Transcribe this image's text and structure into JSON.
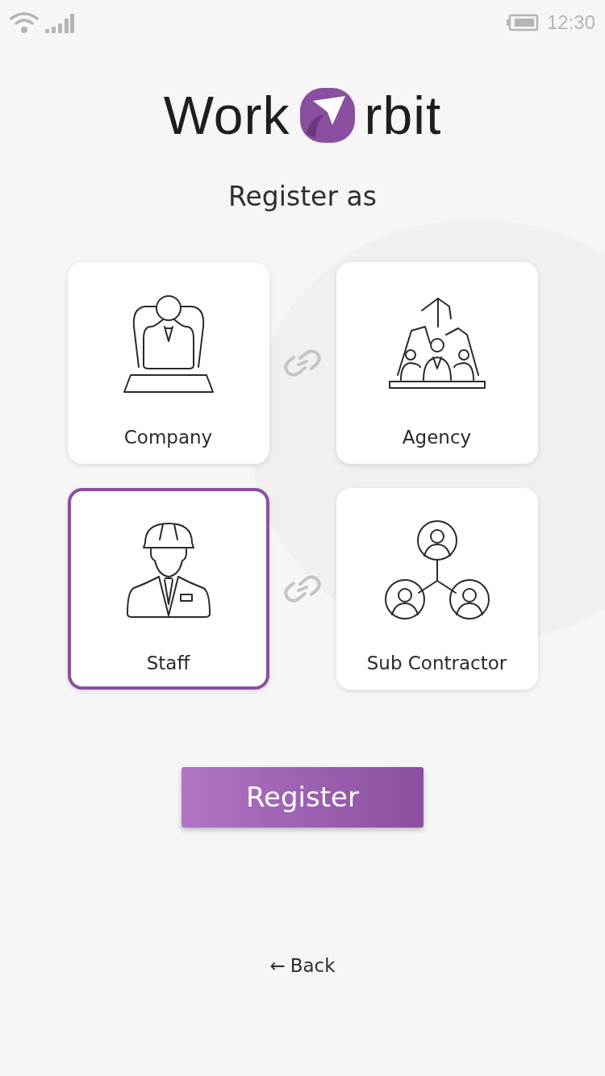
{
  "status_bar": {
    "time": "12:30"
  },
  "logo": {
    "left": "Work",
    "right": "rbit"
  },
  "heading": "Register as",
  "options": [
    {
      "kind": "company",
      "label": "Company",
      "selected": false
    },
    {
      "kind": "agency",
      "label": "Agency",
      "selected": false
    },
    {
      "kind": "staff",
      "label": "Staff",
      "selected": true
    },
    {
      "kind": "subcontractor",
      "label": "Sub Contractor",
      "selected": false
    }
  ],
  "register_button": "Register",
  "back_link": {
    "arrow": "←",
    "label": "Back"
  }
}
